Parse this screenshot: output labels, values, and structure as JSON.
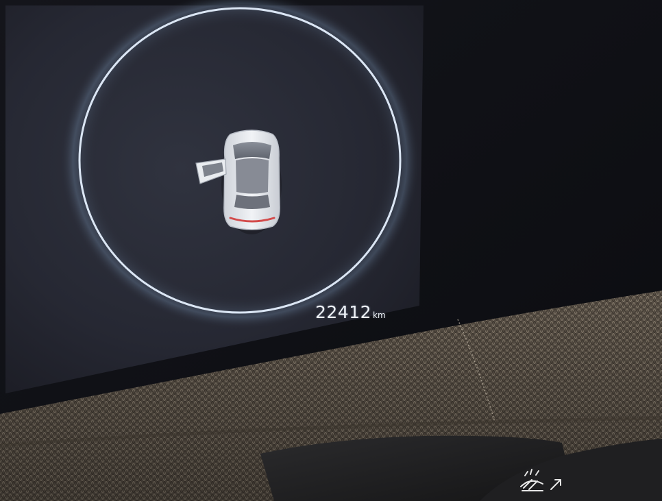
{
  "cluster": {
    "odometer": {
      "value": "22412",
      "unit": "km"
    },
    "indicator": {
      "state": "door-open",
      "ring_color": "#dbe6f4"
    },
    "screen_color": "#282a36",
    "trim_color": "#5f564b"
  },
  "icons": [
    "car-top-view-icon",
    "car-door-open-icon",
    "windshield-wiper-washer-icon"
  ]
}
